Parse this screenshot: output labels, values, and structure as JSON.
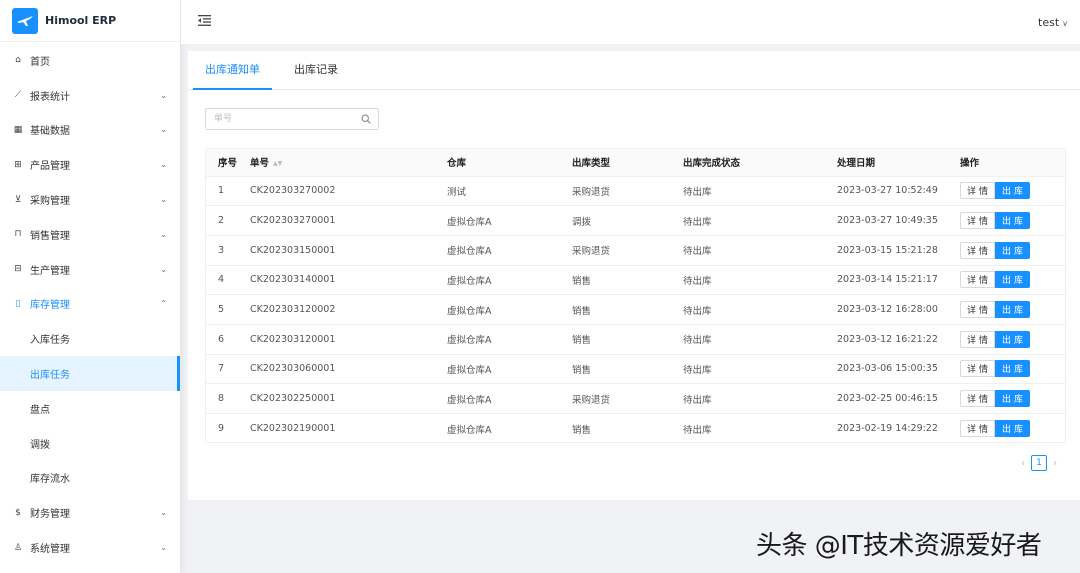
{
  "app": {
    "title": "Himool ERP"
  },
  "sidebar": {
    "items": [
      {
        "label": "首页",
        "icon": "home-icon",
        "glyph": "⌂",
        "expandable": false
      },
      {
        "label": "报表统计",
        "icon": "line-chart-icon",
        "glyph": "⟋",
        "expandable": true
      },
      {
        "label": "基础数据",
        "icon": "table-icon",
        "glyph": "▦",
        "expandable": true
      },
      {
        "label": "产品管理",
        "icon": "appstore-icon",
        "glyph": "⊞",
        "expandable": true
      },
      {
        "label": "采购管理",
        "icon": "shopping-cart-icon",
        "glyph": "⊻",
        "expandable": true
      },
      {
        "label": "销售管理",
        "icon": "shopping-bag-icon",
        "glyph": "⊓",
        "expandable": true
      },
      {
        "label": "生产管理",
        "icon": "calendar-icon",
        "glyph": "⊟",
        "expandable": true
      },
      {
        "label": "库存管理",
        "icon": "container-icon",
        "glyph": "▯",
        "expandable": true,
        "open": true,
        "children": [
          {
            "label": "入库任务",
            "active": false
          },
          {
            "label": "出库任务",
            "active": true
          },
          {
            "label": "盘点",
            "active": false
          },
          {
            "label": "调拨",
            "active": false
          },
          {
            "label": "库存流水",
            "active": false
          }
        ]
      },
      {
        "label": "财务管理",
        "icon": "dollar-icon",
        "glyph": "$",
        "expandable": true
      },
      {
        "label": "系统管理",
        "icon": "team-icon",
        "glyph": "♙",
        "expandable": true
      }
    ]
  },
  "header": {
    "username": "test"
  },
  "tabs": [
    {
      "label": "出库通知单",
      "active": true
    },
    {
      "label": "出库记录",
      "active": false
    }
  ],
  "search": {
    "placeholder": "单号",
    "value": ""
  },
  "table": {
    "columns": [
      "序号",
      "单号",
      "仓库",
      "出库类型",
      "出库完成状态",
      "处理日期",
      "操作"
    ],
    "rows": [
      [
        "1",
        "CK202303270002",
        "测试",
        "采购退货",
        "待出库",
        "2023-03-27 10:52:49"
      ],
      [
        "2",
        "CK202303270001",
        "虚拟仓库A",
        "调拨",
        "待出库",
        "2023-03-27 10:49:35"
      ],
      [
        "3",
        "CK202303150001",
        "虚拟仓库A",
        "采购退货",
        "待出库",
        "2023-03-15 15:21:28"
      ],
      [
        "4",
        "CK202303140001",
        "虚拟仓库A",
        "销售",
        "待出库",
        "2023-03-14 15:21:17"
      ],
      [
        "5",
        "CK202303120002",
        "虚拟仓库A",
        "销售",
        "待出库",
        "2023-03-12 16:28:00"
      ],
      [
        "6",
        "CK202303120001",
        "虚拟仓库A",
        "销售",
        "待出库",
        "2023-03-12 16:21:22"
      ],
      [
        "7",
        "CK202303060001",
        "虚拟仓库A",
        "销售",
        "待出库",
        "2023-03-06 15:00:35"
      ],
      [
        "8",
        "CK202302250001",
        "虚拟仓库A",
        "采购退货",
        "待出库",
        "2023-02-25 00:46:15"
      ],
      [
        "9",
        "CK202302190001",
        "虚拟仓库A",
        "销售",
        "待出库",
        "2023-02-19 14:29:22"
      ]
    ],
    "detail_label": "详情",
    "outbound_label": "出库"
  },
  "pagination": {
    "current": "1"
  },
  "watermark": "头条 @IT技术资源爱好者",
  "colors": {
    "primary": "#1890ff",
    "sidebar_active_bg": "#e6f4ff"
  }
}
